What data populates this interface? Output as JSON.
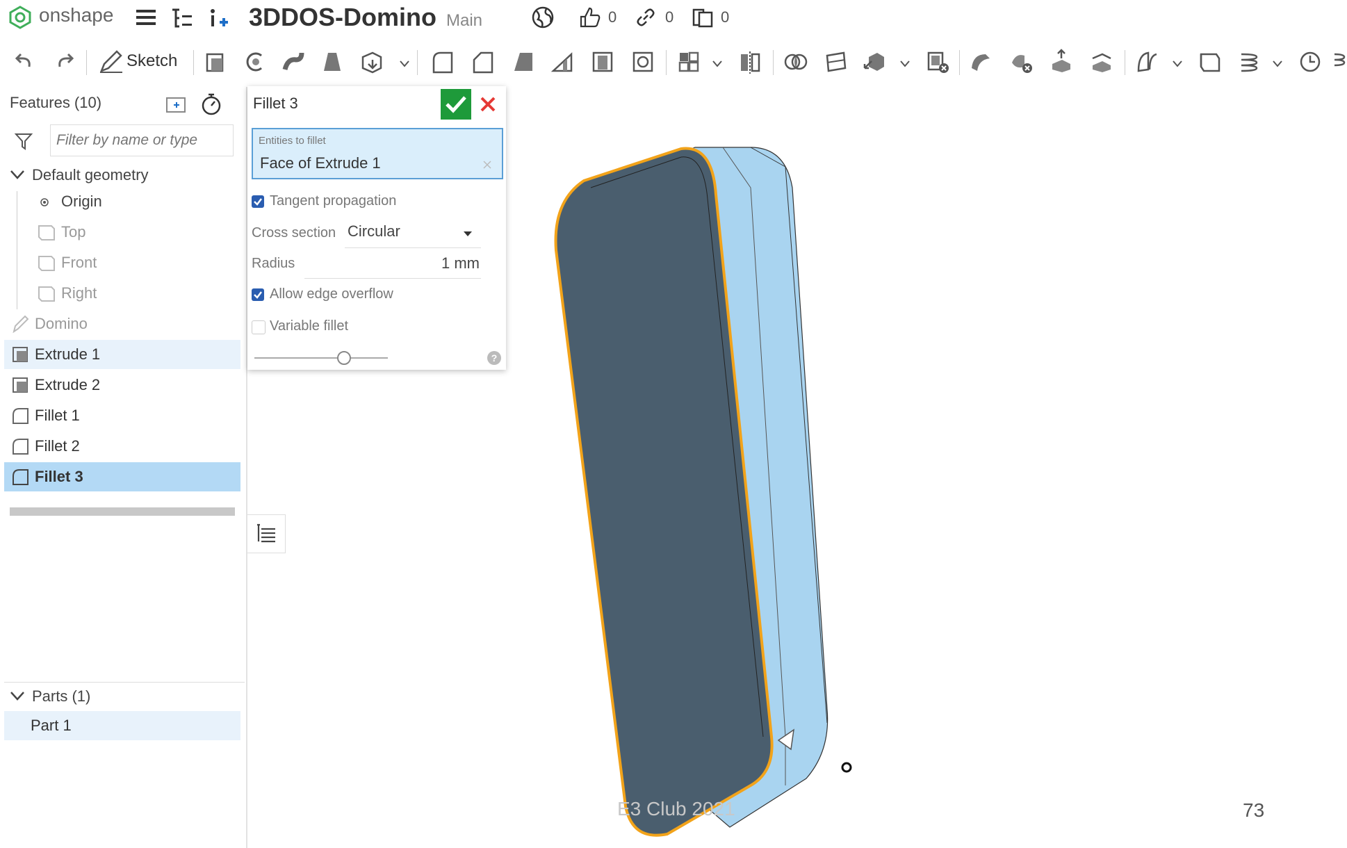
{
  "app": {
    "logo_text": "onshape",
    "document_title": "3DDOS-Domino",
    "workspace": "Main",
    "likes": "0",
    "links": "0",
    "copies": "0"
  },
  "toolbar": {
    "sketch_label": "Sketch"
  },
  "features": {
    "title": "Features (10)",
    "filter_placeholder": "Filter by name or type",
    "default_geometry": "Default geometry",
    "origin": "Origin",
    "planes": [
      "Top",
      "Front",
      "Right"
    ],
    "items": [
      {
        "label": "Domino",
        "icon": "sketch-icon",
        "state": "greyed"
      },
      {
        "label": "Extrude 1",
        "icon": "extrude-icon",
        "state": "highlighted"
      },
      {
        "label": "Extrude 2",
        "icon": "extrude-icon",
        "state": "normal"
      },
      {
        "label": "Fillet 1",
        "icon": "fillet-icon",
        "state": "normal"
      },
      {
        "label": "Fillet 2",
        "icon": "fillet-icon",
        "state": "normal"
      },
      {
        "label": "Fillet 3",
        "icon": "fillet-icon",
        "state": "selected"
      }
    ],
    "parts_header": "Parts (1)",
    "parts": [
      "Part 1"
    ]
  },
  "dialog": {
    "title": "Fillet 3",
    "entities_label": "Entities to fillet",
    "entity_value": "Face of Extrude 1",
    "tangent_propagation": {
      "label": "Tangent propagation",
      "checked": true
    },
    "cross_section": {
      "label": "Cross section",
      "value": "Circular"
    },
    "radius": {
      "label": "Radius",
      "value": "1 mm"
    },
    "allow_edge_overflow": {
      "label": "Allow edge overflow",
      "checked": true
    },
    "variable_fillet": {
      "label": "Variable fillet",
      "checked": false
    },
    "slider_fraction": 0.67
  },
  "footer": {
    "watermark": "E3 Club 2021",
    "page_number": "73"
  },
  "colors": {
    "accept": "#1e9a3a",
    "cancel": "#e53935",
    "selection": "#b3d9f5",
    "model_face": "#4a5e6e",
    "model_side": "#a9d4f0",
    "edge_highlight": "#f2a31a"
  }
}
